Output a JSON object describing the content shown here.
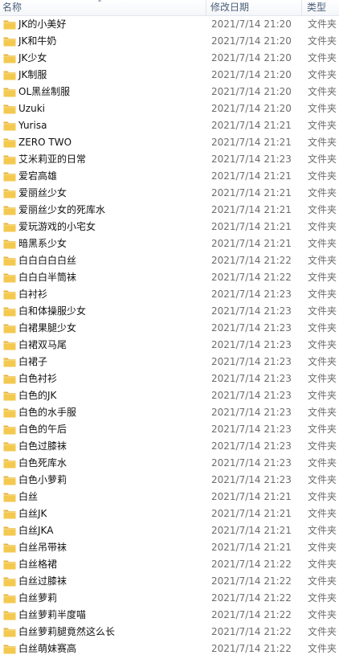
{
  "columns": {
    "name": "名称",
    "date": "修改日期",
    "type": "类型"
  },
  "colors": {
    "folder_body": "#f3c94f",
    "folder_tab": "#e7b43a",
    "header_text": "#4c607a",
    "meta_text": "#6d6d6d"
  },
  "files": [
    {
      "name": "JK的小美好",
      "date": "2021/7/14 21:20",
      "type": "文件夹",
      "icon": "folder-icon"
    },
    {
      "name": "JK和牛奶",
      "date": "2021/7/14 21:20",
      "type": "文件夹",
      "icon": "folder-icon"
    },
    {
      "name": "JK少女",
      "date": "2021/7/14 21:20",
      "type": "文件夹",
      "icon": "folder-icon"
    },
    {
      "name": "JK制服",
      "date": "2021/7/14 21:20",
      "type": "文件夹",
      "icon": "folder-icon"
    },
    {
      "name": "OL黑丝制服",
      "date": "2021/7/14 21:20",
      "type": "文件夹",
      "icon": "folder-icon"
    },
    {
      "name": "Uzuki",
      "date": "2021/7/14 21:20",
      "type": "文件夹",
      "icon": "folder-icon"
    },
    {
      "name": "Yurisa",
      "date": "2021/7/14 21:21",
      "type": "文件夹",
      "icon": "folder-icon"
    },
    {
      "name": "ZERO TWO",
      "date": "2021/7/14 21:21",
      "type": "文件夹",
      "icon": "folder-icon"
    },
    {
      "name": "艾米莉亚的日常",
      "date": "2021/7/14 21:23",
      "type": "文件夹",
      "icon": "folder-icon"
    },
    {
      "name": "爱宕高雄",
      "date": "2021/7/14 21:21",
      "type": "文件夹",
      "icon": "folder-icon"
    },
    {
      "name": "爱丽丝少女",
      "date": "2021/7/14 21:21",
      "type": "文件夹",
      "icon": "folder-icon"
    },
    {
      "name": "爱丽丝少女的死库水",
      "date": "2021/7/14 21:21",
      "type": "文件夹",
      "icon": "folder-icon"
    },
    {
      "name": "爱玩游戏的小宅女",
      "date": "2021/7/14 21:21",
      "type": "文件夹",
      "icon": "folder-icon"
    },
    {
      "name": "暗黑系少女",
      "date": "2021/7/14 21:21",
      "type": "文件夹",
      "icon": "folder-icon"
    },
    {
      "name": "白白白白白丝",
      "date": "2021/7/14 21:22",
      "type": "文件夹",
      "icon": "folder-icon"
    },
    {
      "name": "白白白半筒袜",
      "date": "2021/7/14 21:22",
      "type": "文件夹",
      "icon": "folder-icon"
    },
    {
      "name": "白衬衫",
      "date": "2021/7/14 21:23",
      "type": "文件夹",
      "icon": "folder-icon"
    },
    {
      "name": "白和体操服少女",
      "date": "2021/7/14 21:23",
      "type": "文件夹",
      "icon": "folder-icon"
    },
    {
      "name": "白裙果腿少女",
      "date": "2021/7/14 21:23",
      "type": "文件夹",
      "icon": "folder-icon"
    },
    {
      "name": "白裙双马尾",
      "date": "2021/7/14 21:23",
      "type": "文件夹",
      "icon": "folder-icon"
    },
    {
      "name": "白裙子",
      "date": "2021/7/14 21:23",
      "type": "文件夹",
      "icon": "folder-icon"
    },
    {
      "name": "白色衬衫",
      "date": "2021/7/14 21:23",
      "type": "文件夹",
      "icon": "folder-icon"
    },
    {
      "name": "白色的JK",
      "date": "2021/7/14 21:23",
      "type": "文件夹",
      "icon": "folder-icon"
    },
    {
      "name": "白色的水手服",
      "date": "2021/7/14 21:23",
      "type": "文件夹",
      "icon": "folder-icon"
    },
    {
      "name": "白色的午后",
      "date": "2021/7/14 21:23",
      "type": "文件夹",
      "icon": "folder-icon"
    },
    {
      "name": "白色过膝袜",
      "date": "2021/7/14 21:23",
      "type": "文件夹",
      "icon": "folder-icon"
    },
    {
      "name": "白色死库水",
      "date": "2021/7/14 21:23",
      "type": "文件夹",
      "icon": "folder-icon"
    },
    {
      "name": "白色小萝莉",
      "date": "2021/7/14 21:23",
      "type": "文件夹",
      "icon": "folder-icon"
    },
    {
      "name": "白丝",
      "date": "2021/7/14 21:21",
      "type": "文件夹",
      "icon": "folder-icon"
    },
    {
      "name": "白丝JK",
      "date": "2021/7/14 21:21",
      "type": "文件夹",
      "icon": "folder-icon"
    },
    {
      "name": "白丝JKA",
      "date": "2021/7/14 21:21",
      "type": "文件夹",
      "icon": "folder-icon"
    },
    {
      "name": "白丝吊带袜",
      "date": "2021/7/14 21:21",
      "type": "文件夹",
      "icon": "folder-icon"
    },
    {
      "name": "白丝格裙",
      "date": "2021/7/14 21:22",
      "type": "文件夹",
      "icon": "folder-icon"
    },
    {
      "name": "白丝过膝袜",
      "date": "2021/7/14 21:22",
      "type": "文件夹",
      "icon": "folder-icon"
    },
    {
      "name": "白丝萝莉",
      "date": "2021/7/14 21:22",
      "type": "文件夹",
      "icon": "folder-icon"
    },
    {
      "name": "白丝萝莉半度喵",
      "date": "2021/7/14 21:22",
      "type": "文件夹",
      "icon": "folder-icon"
    },
    {
      "name": "白丝萝莉腿竟然这么长",
      "date": "2021/7/14 21:22",
      "type": "文件夹",
      "icon": "folder-icon"
    },
    {
      "name": "白丝萌妹赛高",
      "date": "2021/7/14 21:22",
      "type": "文件夹",
      "icon": "folder-icon"
    }
  ]
}
